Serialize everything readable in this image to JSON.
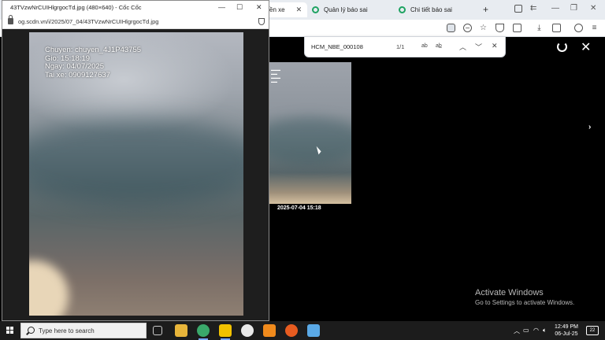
{
  "main_browser": {
    "tabs": [
      {
        "label": "ền xe",
        "active": true
      },
      {
        "label": "Quản lý báo sai",
        "active": false
      },
      {
        "label": "Chi tiết báo sai",
        "active": false
      }
    ],
    "find_bar": {
      "query": "HCM_NBE_000108",
      "count": "1/1",
      "match_case": "ab",
      "whole_word": "ab̲"
    },
    "viewer": {
      "thumbnail_caption": "2025-07-04 15:18"
    }
  },
  "popup": {
    "title": "43TVzwNrCUIHlgrgocTd.jpg (480×640) - Cốc Cốc",
    "url": "og.scdn.vn/i/2025/07_04/43TVzwNrCUIHlgrgocTd.jpg",
    "photo_overlay": [
      "Chuyen: chuyen_4J1P43755",
      "Gio: 15:18:19",
      "Ngay: 04/07/2025",
      "Tai xe: 0909127637"
    ]
  },
  "activation": {
    "title": "Activate Windows",
    "subtitle": "Go to Settings to activate Windows."
  },
  "taskbar": {
    "search_placeholder": "Type here to search",
    "time": "12:49 PM",
    "date": "06-Jul-25",
    "notifications": "22",
    "colors": {
      "accent": "#7aa7ff"
    }
  }
}
